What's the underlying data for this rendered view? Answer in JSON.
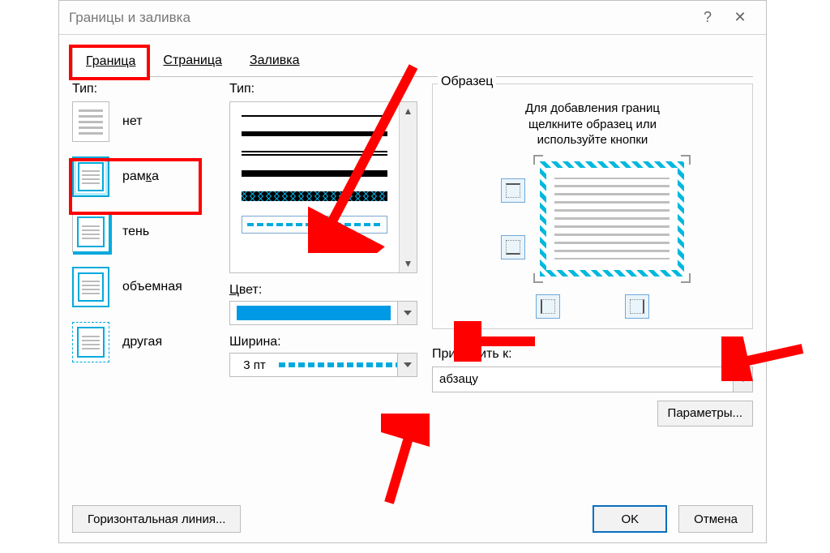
{
  "dialog": {
    "title": "Границы и заливка",
    "help_symbol": "?",
    "close_symbol": "✕"
  },
  "tabs": {
    "border": "Граница",
    "page": "Страница",
    "shading": "Заливка"
  },
  "left": {
    "label": "Тип:",
    "none": "нет",
    "box": "рамка",
    "shadow": "тень",
    "threed": "объемная",
    "custom": "другая"
  },
  "mid": {
    "style_label": "Тип:",
    "color_label": "Цвет:",
    "width_label": "Ширина:",
    "width_value": "3 пт"
  },
  "right": {
    "legend": "Образец",
    "hint1": "Для добавления границ",
    "hint2": "щелкните образец или",
    "hint3": "используйте кнопки",
    "apply_label": "Применить к:",
    "apply_value": "абзацу",
    "params": "Параметры..."
  },
  "bottom": {
    "hline": "Горизонтальная линия...",
    "ok": "OK",
    "cancel": "Отмена"
  },
  "colors": {
    "accent": "#00aadd",
    "annotation": "#ff0000"
  }
}
